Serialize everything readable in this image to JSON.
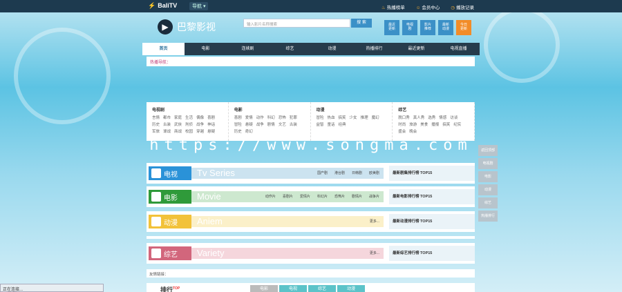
{
  "topbar": {
    "logo": "BaliTV",
    "location": "导航 ▾",
    "links": [
      "热播榜单",
      "会员中心",
      "播放记录"
    ]
  },
  "brand": {
    "name": "巴黎影视"
  },
  "search": {
    "placeholder": "输入影片名称搜索",
    "button": "搜 索"
  },
  "quick": [
    {
      "l1": "最近",
      "l2": "更新",
      "hot": false
    },
    {
      "l1": "电视",
      "l2": "剧",
      "hot": false
    },
    {
      "l1": "影片",
      "l2": "推荐",
      "hot": false
    },
    {
      "l1": "最新",
      "l2": "动漫",
      "hot": false
    },
    {
      "l1": "今日",
      "l2": "更新",
      "hot": true
    }
  ],
  "nav": [
    "首页",
    "电影",
    "连续剧",
    "综艺",
    "动漫",
    "热播排行",
    "最近更新",
    "电视直播"
  ],
  "hotbar": {
    "label": "热播导航："
  },
  "categories": [
    {
      "title": "电视剧",
      "items": [
        "言情",
        "都市",
        "家庭",
        "生活",
        "偶像",
        "喜剧",
        "历史",
        "古装",
        "武侠",
        "刑侦",
        "战争",
        "神话",
        "军旅",
        "谍战",
        "商战",
        "校园",
        "穿越",
        "悬疑"
      ]
    },
    {
      "title": "电影",
      "items": [
        "喜剧",
        "爱情",
        "动作",
        "科幻",
        "恐怖",
        "犯罪",
        "冒险",
        "悬疑",
        "战争",
        "剧情",
        "文艺",
        "古装",
        "历史",
        "奇幻"
      ]
    },
    {
      "title": "动漫",
      "items": [
        "冒险",
        "热血",
        "搞笑",
        "少女",
        "推理",
        "魔幻",
        "益智",
        "童话",
        "经典"
      ]
    },
    {
      "title": "综艺",
      "items": [
        "脱口秀",
        "真人秀",
        "选秀",
        "情感",
        "访谈",
        "时尚",
        "旅游",
        "美食",
        "播报",
        "搞笑",
        "纪实",
        "盛会",
        "晚会"
      ]
    }
  ],
  "watermark": "https://www.songma.com",
  "sections": [
    {
      "cls": "sec-tv",
      "icon": "TV",
      "title": "电视",
      "en": "Tv Series",
      "links": [
        "国产剧",
        "港台剧",
        "日韩剧",
        "欧美剧"
      ],
      "rank": "最新剧集排行榜 TOP15"
    },
    {
      "cls": "sec-mv",
      "icon": "M",
      "title": "电影",
      "en": "Movie",
      "links": [
        "动作片",
        "喜剧片",
        "爱情片",
        "科幻片",
        "恐怖片",
        "剧情片",
        "战争片"
      ],
      "rank": "最新电影排行榜 TOP15"
    },
    {
      "cls": "sec-an",
      "icon": "C",
      "title": "动漫",
      "en": "Aniem",
      "links": [
        "更多..."
      ],
      "rank": "最新动漫排行榜 TOP15"
    },
    {
      "cls": "sec-va",
      "icon": "V",
      "title": "综艺",
      "en": "Variety",
      "links": [
        "更多..."
      ],
      "rank": "最新综艺排行榜 TOP15"
    }
  ],
  "friendlinks": "友情链接：",
  "rankbar": {
    "title": "排行",
    "sup": "TOP",
    "tabs": [
      "电影",
      "电视",
      "综艺",
      "动漫"
    ]
  },
  "side": [
    "返回顶部",
    "电视剧",
    "电影",
    "动漫",
    "综艺",
    "热播排行"
  ],
  "status": "正在连接..."
}
